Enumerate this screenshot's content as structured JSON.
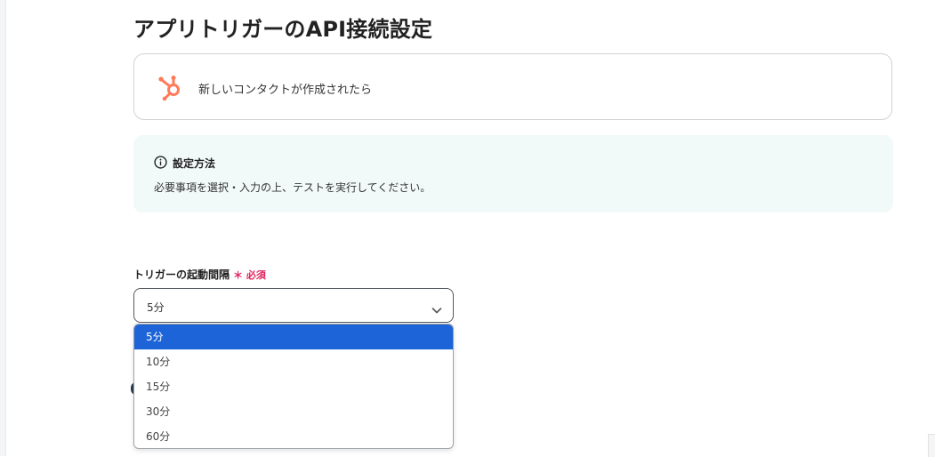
{
  "page": {
    "title": "アプリトリガーのAPI接続設定"
  },
  "app_card": {
    "icon": "hubspot-icon",
    "brand_color": "#ff7a59",
    "trigger_label": "新しいコンタクトが作成されたら"
  },
  "info_box": {
    "icon": "info-circle-icon",
    "title": "設定方法",
    "text": "必要事項を選択・入力の上、テストを実行してください。"
  },
  "trigger_interval": {
    "label": "トリガーの起動間隔",
    "required_text": "＊ 必須",
    "selected_value": "5分",
    "options": [
      "5分",
      "10分",
      "15分",
      "30分",
      "60分"
    ],
    "highlighted_index": 0,
    "highlight_color": "#1c64d8",
    "required_color": "#e0245e"
  }
}
